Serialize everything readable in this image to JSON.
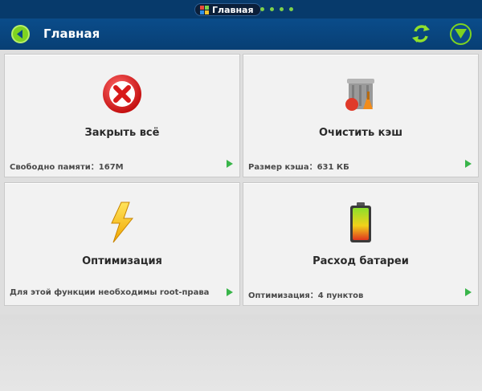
{
  "status_bar": {
    "tab_label": "Главная",
    "page_dots": 4,
    "colors": {
      "background": "#073a6b",
      "dot": "#7fd24a"
    }
  },
  "header": {
    "title": "Главная",
    "back_icon": "back-arrow-icon",
    "refresh_icon": "refresh-icon",
    "menu_icon": "dropdown-menu-icon",
    "colors": {
      "background": "#0a4c8a",
      "accent": "#7ed321"
    }
  },
  "cards": [
    {
      "id": "close-all",
      "title": "Закрыть всё",
      "subtitle": "Свободно памяти：167M",
      "icon": "close-red-icon"
    },
    {
      "id": "clear-cache",
      "title": "Очистить кэш",
      "subtitle": "Размер кэша：631 КБ",
      "icon": "trash-can-icon"
    },
    {
      "id": "optimization",
      "title": "Оптимизация",
      "subtitle": "Для этой функции необходимы root-права",
      "icon": "lightning-icon"
    },
    {
      "id": "battery",
      "title": "Расход батареи",
      "subtitle": "Оптимизация：4 пунктов",
      "icon": "battery-icon"
    }
  ],
  "colors": {
    "card_bg": "#f2f2f2",
    "arrow": "#39b54a",
    "page_bg": "#e3e3e3"
  }
}
